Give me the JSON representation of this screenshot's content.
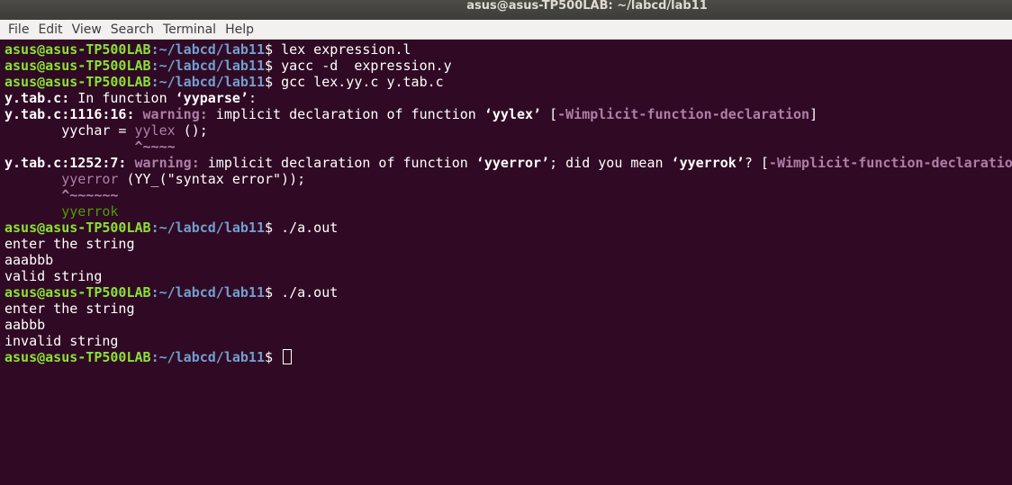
{
  "window": {
    "title": "asus@asus-TP500LAB: ~/labcd/lab11"
  },
  "menubar": {
    "file": "File",
    "edit": "Edit",
    "view": "View",
    "search": "Search",
    "terminal": "Terminal",
    "help": "Help"
  },
  "prompt": {
    "user": "asus@asus-TP500LAB",
    "path": ":~/labcd/lab11",
    "sign": "$ "
  },
  "terminal": {
    "cmd1": "lex expression.l",
    "cmd2": "yacc -d  expression.y",
    "cmd3": "gcc lex.yy.c y.tab.c",
    "err1_file": "y.tab.c:",
    "err1_text_a": " In function ",
    "err1_func": "‘yyparse’",
    "err1_text_b": ":",
    "w1_loc": "y.tab.c:1116:16:",
    "w1_label": " warning:",
    "w1_text_a": " implicit declaration of function ",
    "w1_func": "‘yylex’",
    "w1_text_b": " [",
    "w1_flag": "-Wimplicit-function-declaration",
    "w1_text_c": "]",
    "w1_code_a": "       yychar = ",
    "w1_code_hl": "yylex",
    "w1_code_b": " ();",
    "w1_caret": "                ^~~~~",
    "w2_loc": "y.tab.c:1252:7:",
    "w2_label": " warning:",
    "w2_text_a": " implicit declaration of function ",
    "w2_func": "‘yyerror’",
    "w2_text_b": "; did you mean ",
    "w2_suggest": "‘yyerrok’",
    "w2_text_c": "? [",
    "w2_flag": "-Wimplicit-function-declaration",
    "w2_text_d": "]",
    "w2_code_a": "       ",
    "w2_code_hl": "yyerror",
    "w2_code_b": " (YY_(\"syntax error\"));",
    "w2_caret": "       ^~~~~~~",
    "w2_fix": "       yyerrok",
    "cmd4": "./a.out",
    "out1": "enter the string",
    "in1": "aaabbb",
    "out2": "valid string",
    "cmd5": "./a.out",
    "out3": "enter the string",
    "in2": "aabbb",
    "out4": "invalid string"
  }
}
